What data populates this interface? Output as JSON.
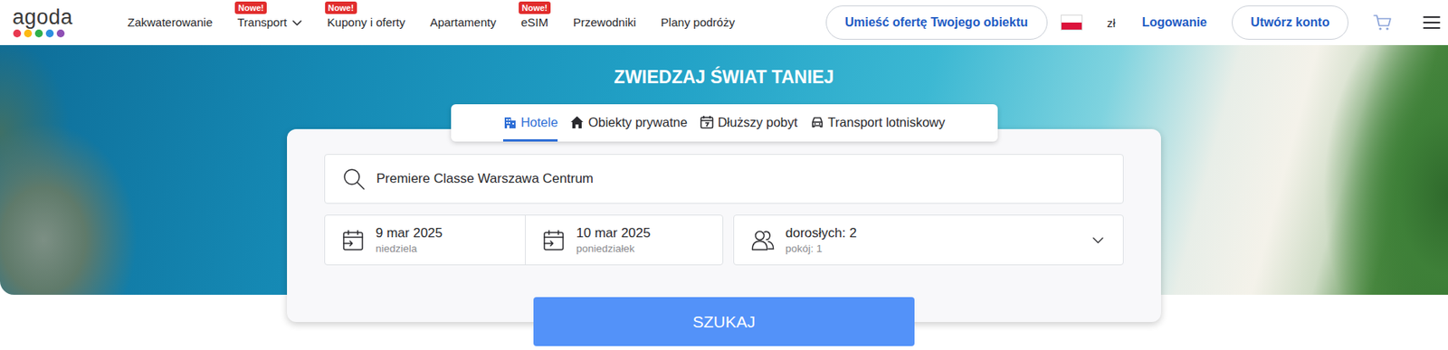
{
  "logo": {
    "text": "agoda",
    "dots": [
      {
        "color": "#e8384f"
      },
      {
        "color": "#fdb913"
      },
      {
        "color": "#2fb04a"
      },
      {
        "color": "#2d8fe0"
      },
      {
        "color": "#8e4fb4"
      }
    ]
  },
  "nav": [
    {
      "label": "Zakwaterowanie",
      "badge": null,
      "dropdown": false
    },
    {
      "label": "Transport",
      "badge": "Nowe!",
      "dropdown": true
    },
    {
      "label": "Kupony i oferty",
      "badge": "Nowe!",
      "dropdown": false
    },
    {
      "label": "Apartamenty",
      "badge": null,
      "dropdown": false
    },
    {
      "label": "eSIM",
      "badge": "Nowe!",
      "dropdown": false
    },
    {
      "label": "Przewodniki",
      "badge": null,
      "dropdown": false
    },
    {
      "label": "Plany podróży",
      "badge": null,
      "dropdown": false
    }
  ],
  "header_actions": {
    "list_property": "Umieść ofertę Twojego obiektu",
    "currency": "zł",
    "login": "Logowanie",
    "signup": "Utwórz konto"
  },
  "hero": {
    "title": "ZWIEDZAJ ŚWIAT TANIEJ"
  },
  "tabs": [
    {
      "label": "Hotele",
      "selected": true
    },
    {
      "label": "Obiekty prywatne",
      "selected": false
    },
    {
      "label": "Dłuższy pobyt",
      "selected": false
    },
    {
      "label": "Transport lotniskowy",
      "selected": false
    }
  ],
  "search": {
    "value": "Premiere Classe Warszawa Centrum"
  },
  "dates": [
    {
      "date": "9 mar 2025",
      "weekday": "niedziela"
    },
    {
      "date": "10 mar 2025",
      "weekday": "poniedziałek"
    }
  ],
  "guests": {
    "adults": "dorosłych: 2",
    "rooms": "pokój: 1"
  },
  "button": "SZUKAJ"
}
